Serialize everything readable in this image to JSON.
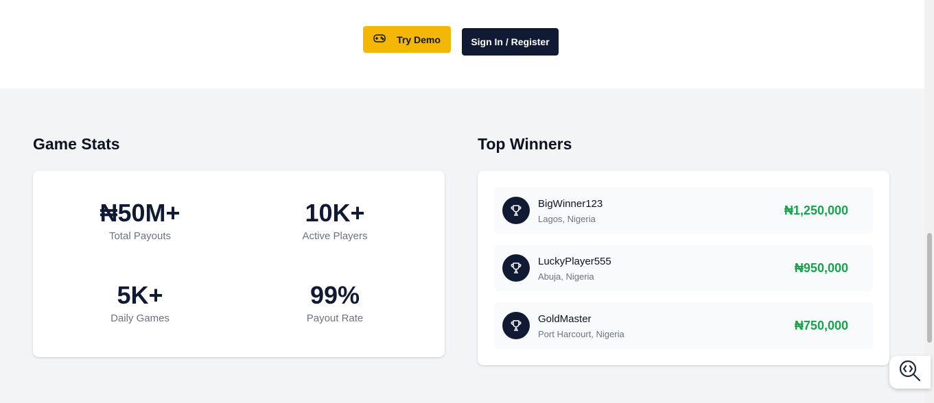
{
  "header": {
    "try_demo_label": "Try Demo",
    "signin_label": "Sign In / Register"
  },
  "game_stats": {
    "title": "Game Stats",
    "items": [
      {
        "value": "₦50M+",
        "label": "Total Payouts"
      },
      {
        "value": "10K+",
        "label": "Active Players"
      },
      {
        "value": "5K+",
        "label": "Daily Games"
      },
      {
        "value": "99%",
        "label": "Payout Rate"
      }
    ]
  },
  "top_winners": {
    "title": "Top Winners",
    "items": [
      {
        "name": "BigWinner123",
        "location": "Lagos, Nigeria",
        "amount": "₦1,250,000"
      },
      {
        "name": "LuckyPlayer555",
        "location": "Abuja, Nigeria",
        "amount": "₦950,000"
      },
      {
        "name": "GoldMaster",
        "location": "Port Harcourt, Nigeria",
        "amount": "₦750,000"
      }
    ]
  },
  "icons": {
    "demo": "gamepad-icon",
    "winner": "trophy-icon",
    "fab": "code-search-icon"
  },
  "colors": {
    "accent": "#f5b705",
    "primary_dark": "#111a33",
    "winnings_green": "#16a34a"
  }
}
